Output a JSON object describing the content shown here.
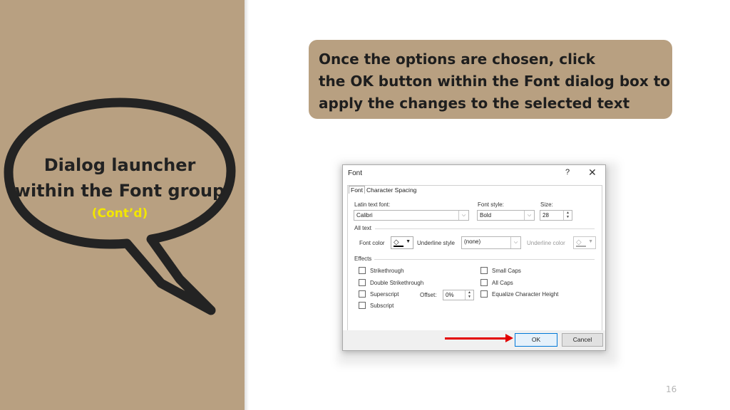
{
  "bubble": {
    "line1": "Dialog launcher",
    "line2": "within the Font group",
    "sub": "(Cont’d)"
  },
  "callout": {
    "line1": "Once the options are chosen, click",
    "line2": "the OK button within the Font dialog box to",
    "line3": "apply the changes to the selected text"
  },
  "dialog": {
    "title": "Font",
    "help": "?",
    "close": "✕",
    "tabs": {
      "font": "Font",
      "character_spacing": "Character Spacing"
    },
    "latin_font_label": "Latin text font:",
    "latin_font_value": "Calibri",
    "font_style_label": "Font style:",
    "font_style_value": "Bold",
    "size_label": "Size:",
    "size_value": "28",
    "all_text_label": "All text",
    "font_color_label": "Font color",
    "underline_style_label": "Underline style",
    "underline_style_value": "(none)",
    "underline_color_label": "Underline color",
    "effects_label": "Effects",
    "effects": {
      "strikethrough": "Strikethrough",
      "double_strikethrough": "Double Strikethrough",
      "superscript": "Superscript",
      "subscript": "Subscript",
      "small_caps": "Small Caps",
      "all_caps": "All Caps",
      "equalize": "Equalize Character Height"
    },
    "offset_label": "Offset:",
    "offset_value": "0%",
    "ok": "OK",
    "cancel": "Cancel"
  },
  "page_number": "16",
  "colors": {
    "panel": "#b8a081",
    "bubble_sub": "#f2e600",
    "arrow": "#e30000",
    "ok_border": "#0078d7"
  }
}
